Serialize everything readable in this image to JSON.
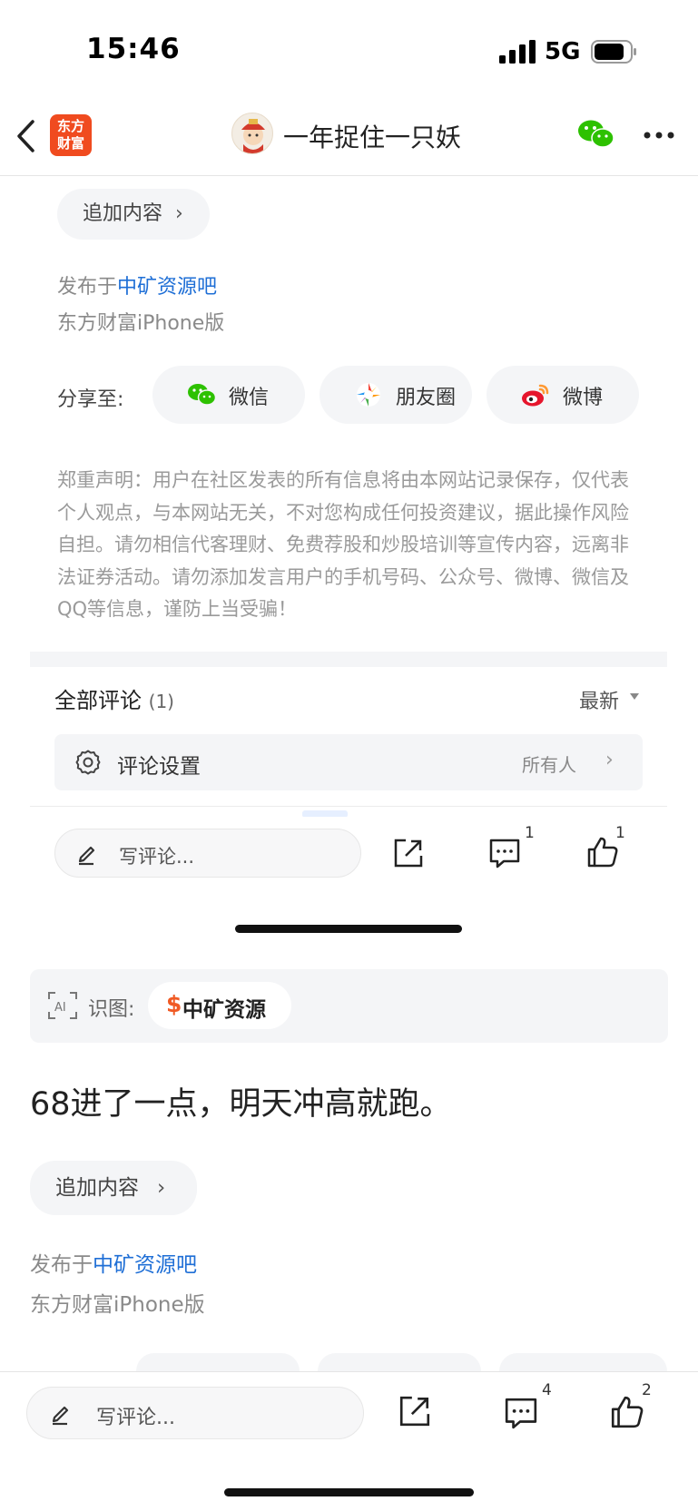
{
  "status_bar": {
    "time": "15:46",
    "network": "5G"
  },
  "nav": {
    "app_logo_text": [
      "东方",
      "财富"
    ],
    "title": "一年捉住一只妖"
  },
  "post_top": {
    "add_content": "追加内容",
    "published_prefix": "发布于",
    "forum": "中矿资源吧",
    "client": "东方财富iPhone版",
    "share_label": "分享至:",
    "share_buttons": [
      {
        "label": "微信",
        "icon": "wechat-icon"
      },
      {
        "label": "朋友圈",
        "icon": "moments-icon"
      },
      {
        "label": "微博",
        "icon": "weibo-icon"
      }
    ],
    "disclaimer": "郑重声明：用户在社区发表的所有信息将由本网站记录保存，仅代表个人观点，与本网站无关，不对您构成任何投资建议，据此操作风险自担。请勿相信代客理财、免费荐股和炒股培训等宣传内容，远离非法证券活动。请勿添加发言用户的手机号码、公众号、微博、微信及QQ等信息，谨防上当受骗！"
  },
  "comments": {
    "title": "全部评论",
    "count": "(1)",
    "sort": "最新",
    "settings_label": "评论设置",
    "settings_value": "所有人"
  },
  "bottom_bar_1": {
    "placeholder": "写评论...",
    "comment_count": "1",
    "like_count": "1"
  },
  "post_bottom": {
    "recognize_label": "识图:",
    "stock_symbol": "$",
    "stock_name": "中矿资源",
    "text": "68进了一点，明天冲高就跑。",
    "add_content": "追加内容",
    "published_prefix": "发布于",
    "forum": "中矿资源吧",
    "client": "东方财富iPhone版"
  },
  "bottom_bar_2": {
    "placeholder": "写评论...",
    "comment_count": "4",
    "like_count": "2"
  },
  "colors": {
    "link": "#1f6fd6",
    "brand": "#f04b1f",
    "wechat": "#2dc100",
    "stock": "#f05a24"
  }
}
